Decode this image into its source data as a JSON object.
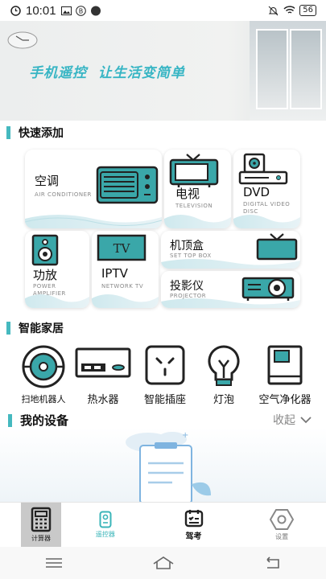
{
  "status_bar": {
    "time": "10:01",
    "battery": "56"
  },
  "banner": {
    "slogan": "手机遥控  让生活变简单"
  },
  "quick_add": {
    "title": "快速添加",
    "items": [
      {
        "name": "空调",
        "sub": "AIR CONDITIONER",
        "icon": "air-conditioner-icon"
      },
      {
        "name": "电视",
        "sub": "TELEVISION",
        "icon": "tv-icon"
      },
      {
        "name": "DVD",
        "sub": "DIGITAL VIDEO DISC",
        "icon": "dvd-icon"
      },
      {
        "name": "功放",
        "sub": "POWER AMPLIFIER",
        "icon": "speaker-icon"
      },
      {
        "name": "IPTV",
        "sub": "NETWORK TV",
        "icon": "iptv-icon",
        "icon_text": "TV"
      },
      {
        "name": "机顶盒",
        "sub": "SET TOP BOX",
        "icon": "set-top-box-icon"
      },
      {
        "name": "投影仪",
        "sub": "PROJECTOR",
        "icon": "projector-icon"
      }
    ]
  },
  "smart_home": {
    "title": "智能家居",
    "items": [
      {
        "label": "扫地机器人",
        "icon": "robot-vacuum-icon"
      },
      {
        "label": "热水器",
        "icon": "water-heater-icon"
      },
      {
        "label": "智能插座",
        "icon": "smart-socket-icon"
      },
      {
        "label": "灯泡",
        "icon": "light-bulb-icon"
      },
      {
        "label": "空气净化器",
        "icon": "air-purifier-icon"
      }
    ]
  },
  "my_devices": {
    "title": "我的设备",
    "collapse_label": "收起"
  },
  "tabbar": {
    "tabs": [
      {
        "label": "计算器",
        "icon": "calculator-icon"
      },
      {
        "label": "遥控器",
        "icon": "remote-icon",
        "active": true
      },
      {
        "label": "驾考",
        "icon": "calendar-icon"
      },
      {
        "label": "设置",
        "icon": "settings-icon"
      }
    ]
  },
  "colors": {
    "accent": "#45b9bf",
    "icon_teal": "#3aa7a9",
    "dark": "#222222"
  }
}
